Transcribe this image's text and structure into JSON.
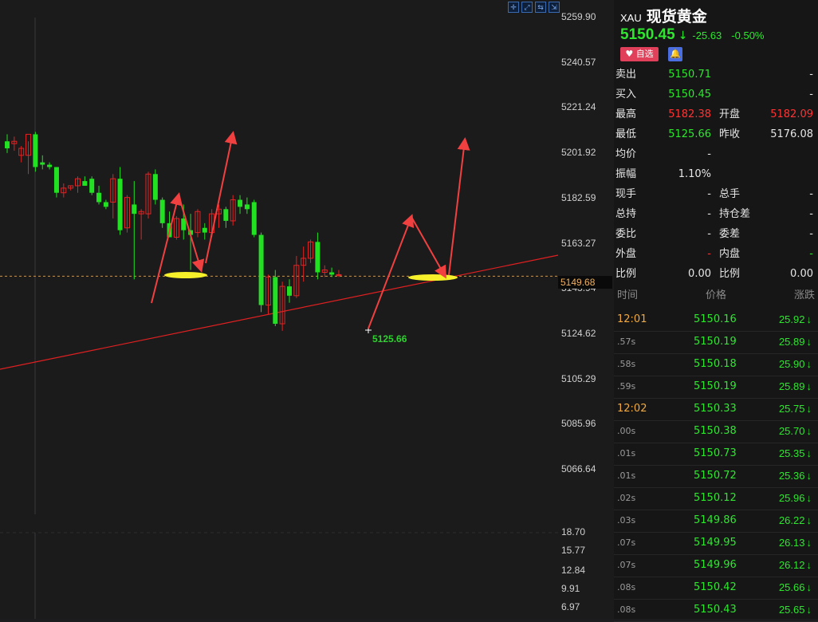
{
  "chart_data": {
    "type": "candlestick",
    "y_axis_ticks": [
      "5259.90",
      "5240.57",
      "5221.24",
      "5201.92",
      "5182.59",
      "5163.27",
      "5143.94",
      "5124.62",
      "5105.29",
      "5085.96",
      "5066.64"
    ],
    "ylim": [
      5066.64,
      5259.9
    ],
    "current_price_label": "5149.68",
    "current_price": 5149.68,
    "low_marker_label": "5125.66",
    "volume_ticks": [
      "18.70",
      "15.77",
      "12.84",
      "9.91",
      "6.97"
    ],
    "candles": [
      {
        "o": 5207,
        "h": 5210,
        "l": 5202,
        "c": 5204
      },
      {
        "o": 5206,
        "h": 5209,
        "l": 5203,
        "c": 5207
      },
      {
        "o": 5201,
        "h": 5205,
        "l": 5198,
        "c": 5204
      },
      {
        "o": 5201,
        "h": 5207,
        "l": 5193,
        "c": 5210
      },
      {
        "o": 5210,
        "h": 5211,
        "l": 5194,
        "c": 5196
      },
      {
        "o": 5198,
        "h": 5201,
        "l": 5195,
        "c": 5197
      },
      {
        "o": 5197,
        "h": 5198,
        "l": 5195,
        "c": 5196
      },
      {
        "o": 5196,
        "h": 5196,
        "l": 5183,
        "c": 5185
      },
      {
        "o": 5185,
        "h": 5189,
        "l": 5183,
        "c": 5187
      },
      {
        "o": 5187,
        "h": 5188,
        "l": 5186,
        "c": 5188
      },
      {
        "o": 5188,
        "h": 5192,
        "l": 5185,
        "c": 5191
      },
      {
        "o": 5190,
        "h": 5192,
        "l": 5188,
        "c": 5188
      },
      {
        "o": 5191,
        "h": 5192,
        "l": 5184,
        "c": 5185
      },
      {
        "o": 5185,
        "h": 5188,
        "l": 5180,
        "c": 5181
      },
      {
        "o": 5181,
        "h": 5182,
        "l": 5178,
        "c": 5179
      },
      {
        "o": 5181,
        "h": 5193,
        "l": 5174,
        "c": 5191
      },
      {
        "o": 5191,
        "h": 5196,
        "l": 5167,
        "c": 5169
      },
      {
        "o": 5170,
        "h": 5184,
        "l": 5168,
        "c": 5183
      },
      {
        "o": 5180,
        "h": 5190,
        "l": 5148,
        "c": 5176
      },
      {
        "o": 5176,
        "h": 5178,
        "l": 5165,
        "c": 5177
      },
      {
        "o": 5176,
        "h": 5194,
        "l": 5174,
        "c": 5193
      },
      {
        "o": 5193,
        "h": 5195,
        "l": 5180,
        "c": 5182
      },
      {
        "o": 5182,
        "h": 5183,
        "l": 5170,
        "c": 5172
      },
      {
        "o": 5172,
        "h": 5177,
        "l": 5166,
        "c": 5166
      },
      {
        "o": 5166,
        "h": 5175,
        "l": 5165,
        "c": 5174
      },
      {
        "o": 5174,
        "h": 5180,
        "l": 5165,
        "c": 5169
      },
      {
        "o": 5169,
        "h": 5176,
        "l": 5152,
        "c": 5167
      },
      {
        "o": 5168,
        "h": 5178,
        "l": 5166,
        "c": 5177
      },
      {
        "o": 5170,
        "h": 5172,
        "l": 5165,
        "c": 5168
      },
      {
        "o": 5168,
        "h": 5178,
        "l": 5166,
        "c": 5176
      },
      {
        "o": 5176,
        "h": 5180,
        "l": 5170,
        "c": 5178
      },
      {
        "o": 5178,
        "h": 5179,
        "l": 5170,
        "c": 5173
      },
      {
        "o": 5173,
        "h": 5184,
        "l": 5171,
        "c": 5182
      },
      {
        "o": 5182,
        "h": 5184,
        "l": 5176,
        "c": 5179
      },
      {
        "o": 5180,
        "h": 5183,
        "l": 5176,
        "c": 5178
      },
      {
        "o": 5181,
        "h": 5182,
        "l": 5166,
        "c": 5167
      },
      {
        "o": 5167,
        "h": 5168,
        "l": 5134,
        "c": 5137
      },
      {
        "o": 5137,
        "h": 5150,
        "l": 5133,
        "c": 5149
      },
      {
        "o": 5149,
        "h": 5152,
        "l": 5128,
        "c": 5129
      },
      {
        "o": 5129,
        "h": 5147,
        "l": 5126,
        "c": 5145
      },
      {
        "o": 5145,
        "h": 5148,
        "l": 5138,
        "c": 5141
      },
      {
        "o": 5141,
        "h": 5158,
        "l": 5140,
        "c": 5154
      },
      {
        "o": 5154,
        "h": 5162,
        "l": 5147,
        "c": 5157
      },
      {
        "o": 5157,
        "h": 5165,
        "l": 5155,
        "c": 5164
      },
      {
        "o": 5164,
        "h": 5168,
        "l": 5148,
        "c": 5151
      },
      {
        "o": 5151,
        "h": 5154,
        "l": 5149,
        "c": 5152
      },
      {
        "o": 5151,
        "h": 5153,
        "l": 5149,
        "c": 5150
      },
      {
        "o": 5150,
        "h": 5152,
        "l": 5149,
        "c": 5150
      }
    ]
  },
  "panel": {
    "symbol_code": "XAU",
    "symbol_name": "现货黄金",
    "last_price": "5150.45",
    "change": "-25.63",
    "change_pct": "-0.50%",
    "fav_label": "自选",
    "quotes": [
      {
        "label": "卖出",
        "value": "5150.71",
        "label2": "",
        "value2": "-"
      },
      {
        "label": "买入",
        "value": "5150.45",
        "label2": "",
        "value2": "-"
      },
      {
        "label": "最高",
        "value": "5182.38",
        "label2": "开盘",
        "value2": "5182.09"
      },
      {
        "label": "最低",
        "value": "5125.66",
        "label2": "昨收",
        "value2": "5176.08"
      },
      {
        "label": "均价",
        "value": "-",
        "label2": "",
        "value2": ""
      },
      {
        "label": "振幅",
        "value": "1.10%",
        "label2": "",
        "value2": ""
      },
      {
        "label": "现手",
        "value": "-",
        "label2": "总手",
        "value2": "-"
      },
      {
        "label": "总持",
        "value": "-",
        "label2": "持仓差",
        "value2": "-"
      },
      {
        "label": "委比",
        "value": "-",
        "label2": "委差",
        "value2": "-"
      },
      {
        "label": "外盘",
        "value": "-",
        "label2": "内盘",
        "value2": "-"
      },
      {
        "label": "比例",
        "value": "0.00",
        "label2": "比例",
        "value2": "0.00"
      }
    ],
    "tick_headers": {
      "time": "时间",
      "price": "价格",
      "change": "涨跌"
    },
    "ticks": [
      {
        "time": "12:01",
        "price": "5150.16",
        "chg": "25.92"
      },
      {
        "time": ".57s",
        "price": "5150.19",
        "chg": "25.89"
      },
      {
        "time": ".58s",
        "price": "5150.18",
        "chg": "25.90"
      },
      {
        "time": ".59s",
        "price": "5150.19",
        "chg": "25.89"
      },
      {
        "time": "12:02",
        "price": "5150.33",
        "chg": "25.75"
      },
      {
        "time": ".00s",
        "price": "5150.38",
        "chg": "25.70"
      },
      {
        "time": ".01s",
        "price": "5150.73",
        "chg": "25.35"
      },
      {
        "time": ".01s",
        "price": "5150.72",
        "chg": "25.36"
      },
      {
        "time": ".02s",
        "price": "5150.12",
        "chg": "25.96"
      },
      {
        "time": ".03s",
        "price": "5149.86",
        "chg": "26.22"
      },
      {
        "time": ".07s",
        "price": "5149.95",
        "chg": "26.13"
      },
      {
        "time": ".07s",
        "price": "5149.96",
        "chg": "26.12"
      },
      {
        "time": ".08s",
        "price": "5150.42",
        "chg": "25.66"
      },
      {
        "time": ".08s",
        "price": "5150.43",
        "chg": "25.65"
      }
    ]
  },
  "colors": {
    "up": "#e02424",
    "down": "#22e022",
    "annotation": "#f04040",
    "highlight": "#f5f02a"
  }
}
